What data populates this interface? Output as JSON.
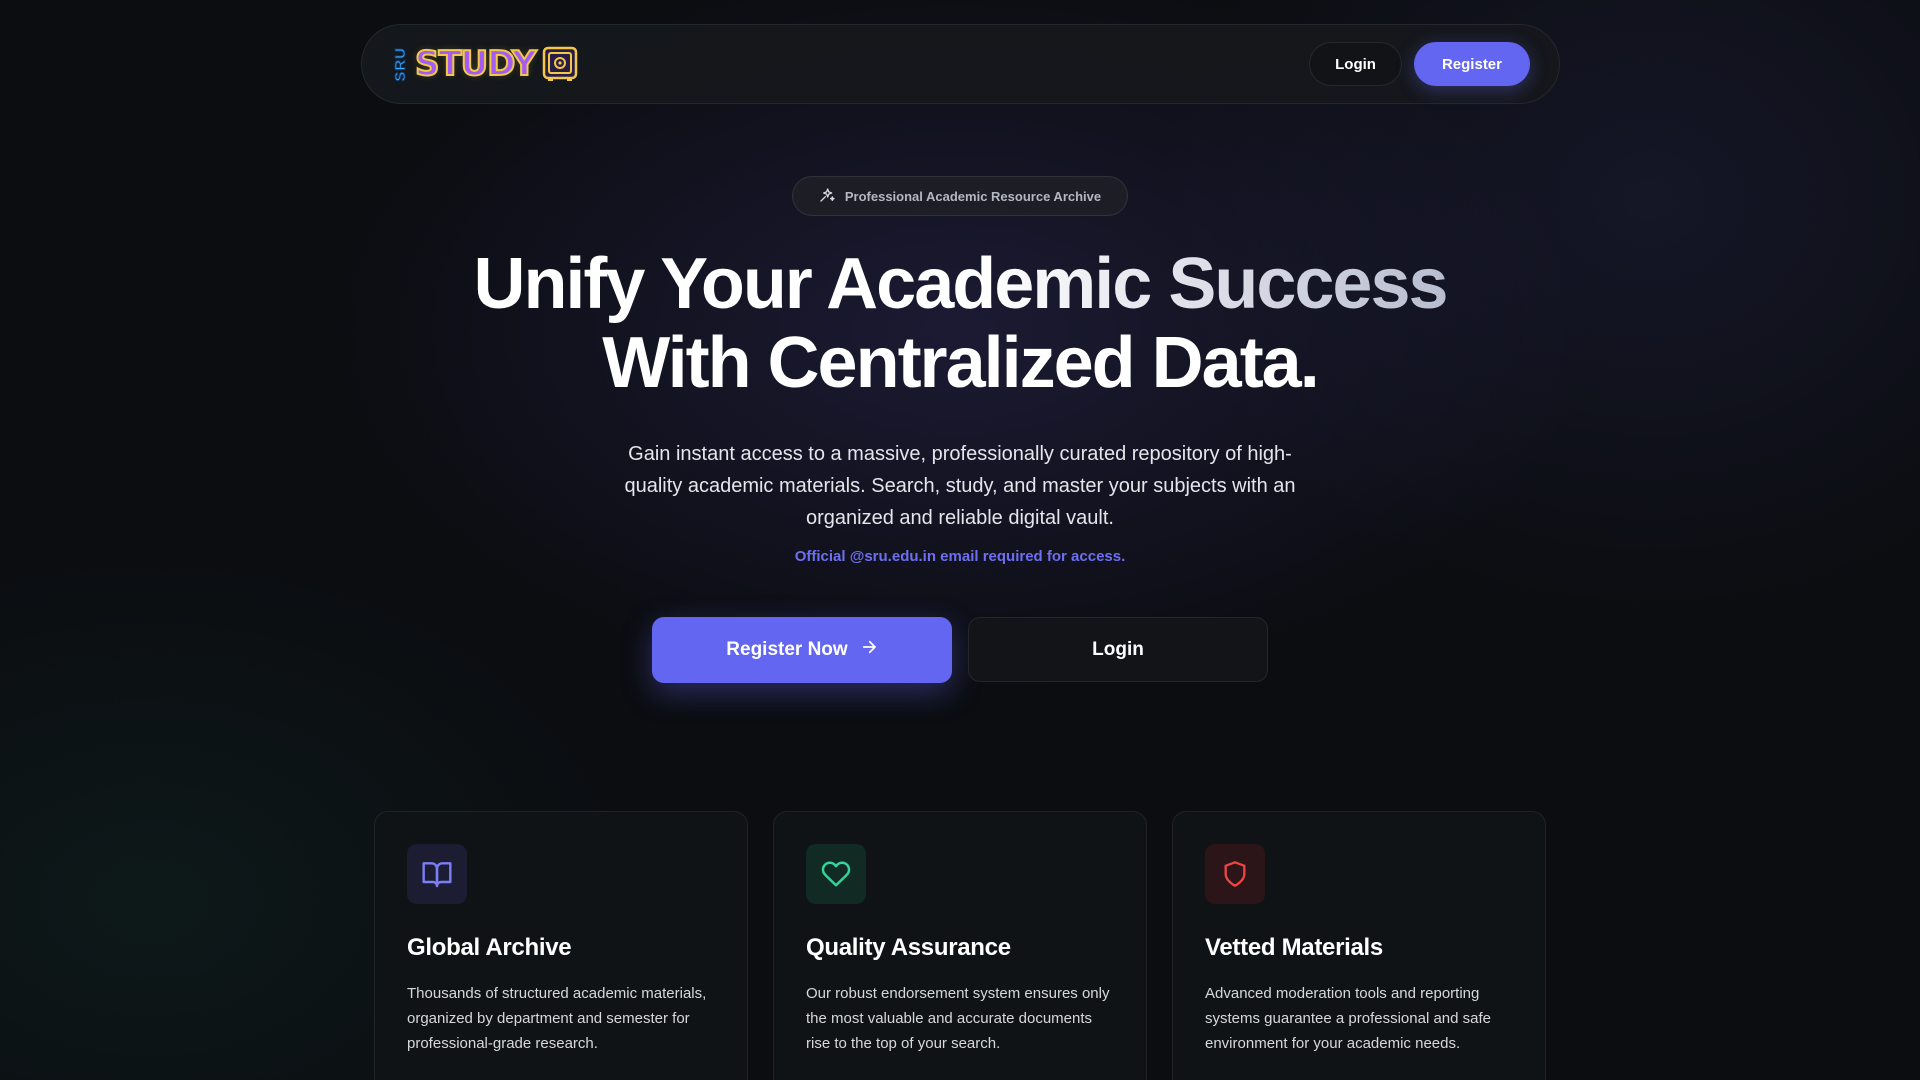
{
  "nav": {
    "logo_vertical": "SRU",
    "logo_text": "STUDY",
    "login_label": "Login",
    "register_label": "Register"
  },
  "hero": {
    "badge": "Professional Academic Resource Archive",
    "title_line1": "Unify Your Academic Success",
    "title_line2": "With Centralized Data.",
    "subtitle": "Gain instant access to a massive, professionally curated repository of high-quality academic materials. Search, study, and master your subjects with an organized and reliable digital vault.",
    "note": "Official @sru.edu.in email required for access.",
    "cta_register": "Register Now",
    "cta_login": "Login"
  },
  "features": [
    {
      "icon": "book-open-icon",
      "title": "Global Archive",
      "text": "Thousands of structured academic materials, organized by department and semester for professional-grade research."
    },
    {
      "icon": "heart-icon",
      "title": "Quality Assurance",
      "text": "Our robust endorsement system ensures only the most valuable and accurate documents rise to the top of your search."
    },
    {
      "icon": "shield-icon",
      "title": "Vetted Materials",
      "text": "Advanced moderation tools and reporting systems guarantee a professional and safe environment for your academic needs."
    }
  ],
  "colors": {
    "accent": "#6366f1",
    "note": "#6d6ff0",
    "book_icon": "#7b7ef5",
    "heart_icon": "#34d399",
    "shield_icon": "#ef4444",
    "logo_purple": "#a45cf2",
    "logo_gold": "#f1c84a",
    "logo_blue": "#3aa7ff"
  }
}
